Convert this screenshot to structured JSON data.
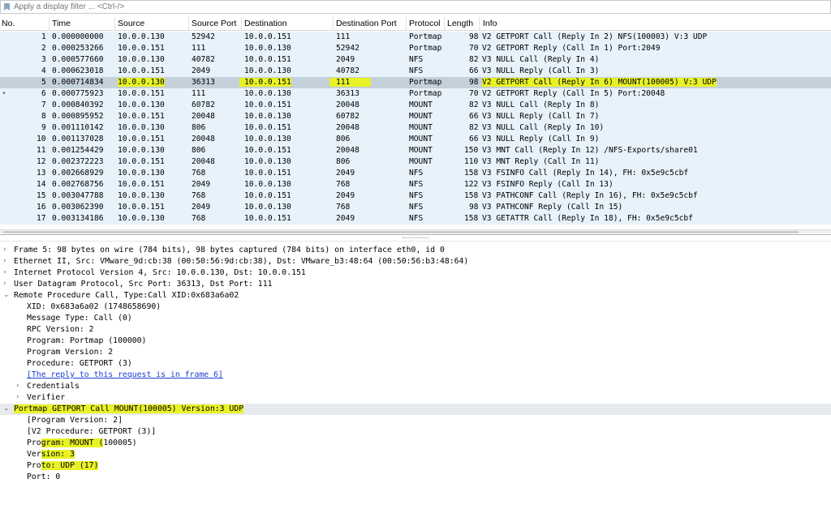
{
  "filter": {
    "placeholder": "Apply a display filter ... <Ctrl-/>",
    "icon": "bookmark-icon"
  },
  "packet_list": {
    "columns": [
      "No.",
      "Time",
      "Source",
      "Source Port",
      "Destination",
      "Destination Port",
      "Protocol",
      "Length",
      "Info"
    ],
    "rows": [
      {
        "no": "1",
        "time": "0.000000000",
        "src": "10.0.0.130",
        "sport": "52942",
        "dst": "10.0.0.151",
        "dport": "111",
        "proto": "Portmap",
        "len": "98",
        "info": "V2 GETPORT Call (Reply In 2) NFS(100003) V:3 UDP"
      },
      {
        "no": "2",
        "time": "0.000253266",
        "src": "10.0.0.151",
        "sport": "111",
        "dst": "10.0.0.130",
        "dport": "52942",
        "proto": "Portmap",
        "len": "70",
        "info": "V2 GETPORT Reply (Call In 1) Port:2049"
      },
      {
        "no": "3",
        "time": "0.000577660",
        "src": "10.0.0.130",
        "sport": "40782",
        "dst": "10.0.0.151",
        "dport": "2049",
        "proto": "NFS",
        "len": "82",
        "info": "V3 NULL Call (Reply In 4)"
      },
      {
        "no": "4",
        "time": "0.000623018",
        "src": "10.0.0.151",
        "sport": "2049",
        "dst": "10.0.0.130",
        "dport": "40782",
        "proto": "NFS",
        "len": "66",
        "info": "V3 NULL Reply (Call In 3)"
      },
      {
        "no": "5",
        "time": "0.000714834",
        "src": "10.0.0.130",
        "sport": "36313",
        "dst": "10.0.0.151",
        "dport": "111",
        "proto": "Portmap",
        "len": "98",
        "info": "V2 GETPORT Call (Reply In 6) MOUNT(100005) V:3 UDP"
      },
      {
        "no": "6",
        "time": "0.000775923",
        "src": "10.0.0.151",
        "sport": "111",
        "dst": "10.0.0.130",
        "dport": "36313",
        "proto": "Portmap",
        "len": "70",
        "info": "V2 GETPORT Reply (Call In 5) Port:20048"
      },
      {
        "no": "7",
        "time": "0.000840392",
        "src": "10.0.0.130",
        "sport": "60782",
        "dst": "10.0.0.151",
        "dport": "20048",
        "proto": "MOUNT",
        "len": "82",
        "info": "V3 NULL Call (Reply In 8)"
      },
      {
        "no": "8",
        "time": "0.000895952",
        "src": "10.0.0.151",
        "sport": "20048",
        "dst": "10.0.0.130",
        "dport": "60782",
        "proto": "MOUNT",
        "len": "66",
        "info": "V3 NULL Reply (Call In 7)"
      },
      {
        "no": "9",
        "time": "0.001110142",
        "src": "10.0.0.130",
        "sport": "806",
        "dst": "10.0.0.151",
        "dport": "20048",
        "proto": "MOUNT",
        "len": "82",
        "info": "V3 NULL Call (Reply In 10)"
      },
      {
        "no": "10",
        "time": "0.001137028",
        "src": "10.0.0.151",
        "sport": "20048",
        "dst": "10.0.0.130",
        "dport": "806",
        "proto": "MOUNT",
        "len": "66",
        "info": "V3 NULL Reply (Call In 9)"
      },
      {
        "no": "11",
        "time": "0.001254429",
        "src": "10.0.0.130",
        "sport": "806",
        "dst": "10.0.0.151",
        "dport": "20048",
        "proto": "MOUNT",
        "len": "150",
        "info": "V3 MNT Call (Reply In 12) /NFS-Exports/share01"
      },
      {
        "no": "12",
        "time": "0.002372223",
        "src": "10.0.0.151",
        "sport": "20048",
        "dst": "10.0.0.130",
        "dport": "806",
        "proto": "MOUNT",
        "len": "110",
        "info": "V3 MNT Reply (Call In 11)"
      },
      {
        "no": "13",
        "time": "0.002668929",
        "src": "10.0.0.130",
        "sport": "768",
        "dst": "10.0.0.151",
        "dport": "2049",
        "proto": "NFS",
        "len": "158",
        "info": "V3 FSINFO Call (Reply In 14), FH: 0x5e9c5cbf"
      },
      {
        "no": "14",
        "time": "0.002768756",
        "src": "10.0.0.151",
        "sport": "2049",
        "dst": "10.0.0.130",
        "dport": "768",
        "proto": "NFS",
        "len": "122",
        "info": "V3 FSINFO Reply (Call In 13)"
      },
      {
        "no": "15",
        "time": "0.003047788",
        "src": "10.0.0.130",
        "sport": "768",
        "dst": "10.0.0.151",
        "dport": "2049",
        "proto": "NFS",
        "len": "158",
        "info": "V3 PATHCONF Call (Reply In 16), FH: 0x5e9c5cbf"
      },
      {
        "no": "16",
        "time": "0.003062390",
        "src": "10.0.0.151",
        "sport": "2049",
        "dst": "10.0.0.130",
        "dport": "768",
        "proto": "NFS",
        "len": "98",
        "info": "V3 PATHCONF Reply (Call In 15)"
      },
      {
        "no": "17",
        "time": "0.003134186",
        "src": "10.0.0.130",
        "sport": "768",
        "dst": "10.0.0.151",
        "dport": "2049",
        "proto": "NFS",
        "len": "158",
        "info": "V3 GETATTR Call (Reply In 18), FH: 0x5e9c5cbf"
      }
    ],
    "selected_row": "5",
    "related_row": "6",
    "related_marker": "•"
  },
  "details": [
    {
      "indent": 0,
      "arrow": "›",
      "text": "Frame 5: 98 bytes on wire (784 bits), 98 bytes captured (784 bits) on interface eth0, id 0"
    },
    {
      "indent": 0,
      "arrow": "›",
      "text": "Ethernet II, Src: VMware_9d:cb:38 (00:50:56:9d:cb:38), Dst: VMware_b3:48:64 (00:50:56:b3:48:64)"
    },
    {
      "indent": 0,
      "arrow": "›",
      "text": "Internet Protocol Version 4, Src: 10.0.0.130, Dst: 10.0.0.151"
    },
    {
      "indent": 0,
      "arrow": "›",
      "text": "User Datagram Protocol, Src Port: 36313, Dst Port: 111"
    },
    {
      "indent": 0,
      "arrow": "⌄",
      "text": "Remote Procedure Call, Type:Call XID:0x683a6a02"
    },
    {
      "indent": 1,
      "arrow": "",
      "text": "XID: 0x683a6a02 (1748658690)"
    },
    {
      "indent": 1,
      "arrow": "",
      "text": "Message Type: Call (0)"
    },
    {
      "indent": 1,
      "arrow": "",
      "text": "RPC Version: 2"
    },
    {
      "indent": 1,
      "arrow": "",
      "text": "Program: Portmap (100000)"
    },
    {
      "indent": 1,
      "arrow": "",
      "text": "Program Version: 2"
    },
    {
      "indent": 1,
      "arrow": "",
      "text": "Procedure: GETPORT (3)"
    },
    {
      "indent": 1,
      "arrow": "",
      "text": "[The reply to this request is in frame 6]",
      "link": true
    },
    {
      "indent": 1,
      "arrow": "›",
      "text": "Credentials"
    },
    {
      "indent": 1,
      "arrow": "›",
      "text": "Verifier"
    },
    {
      "indent": 0,
      "arrow": "⌄",
      "text": "Portmap GETPORT Call MOUNT(100005) Version:3 UDP",
      "selected": true,
      "highlight": true
    },
    {
      "indent": 1,
      "arrow": "",
      "text": "[Program Version: 2]"
    },
    {
      "indent": 1,
      "arrow": "",
      "text": "[V2 Procedure: GETPORT (3)]"
    },
    {
      "indent": 1,
      "arrow": "",
      "text": "Program: MOUNT (100005)",
      "hl_chars": [
        3,
        16
      ]
    },
    {
      "indent": 1,
      "arrow": "",
      "text": "Version: 3",
      "hl_chars": [
        3,
        10
      ]
    },
    {
      "indent": 1,
      "arrow": "",
      "text": "Proto: UDP (17)",
      "hl_chars": [
        3,
        15
      ]
    },
    {
      "indent": 1,
      "arrow": "",
      "text": "Port: 0"
    }
  ],
  "colors": {
    "row_bg": "#e7f2fb",
    "selected_bg": "#c4d0da",
    "highlight": "#e8f226"
  }
}
